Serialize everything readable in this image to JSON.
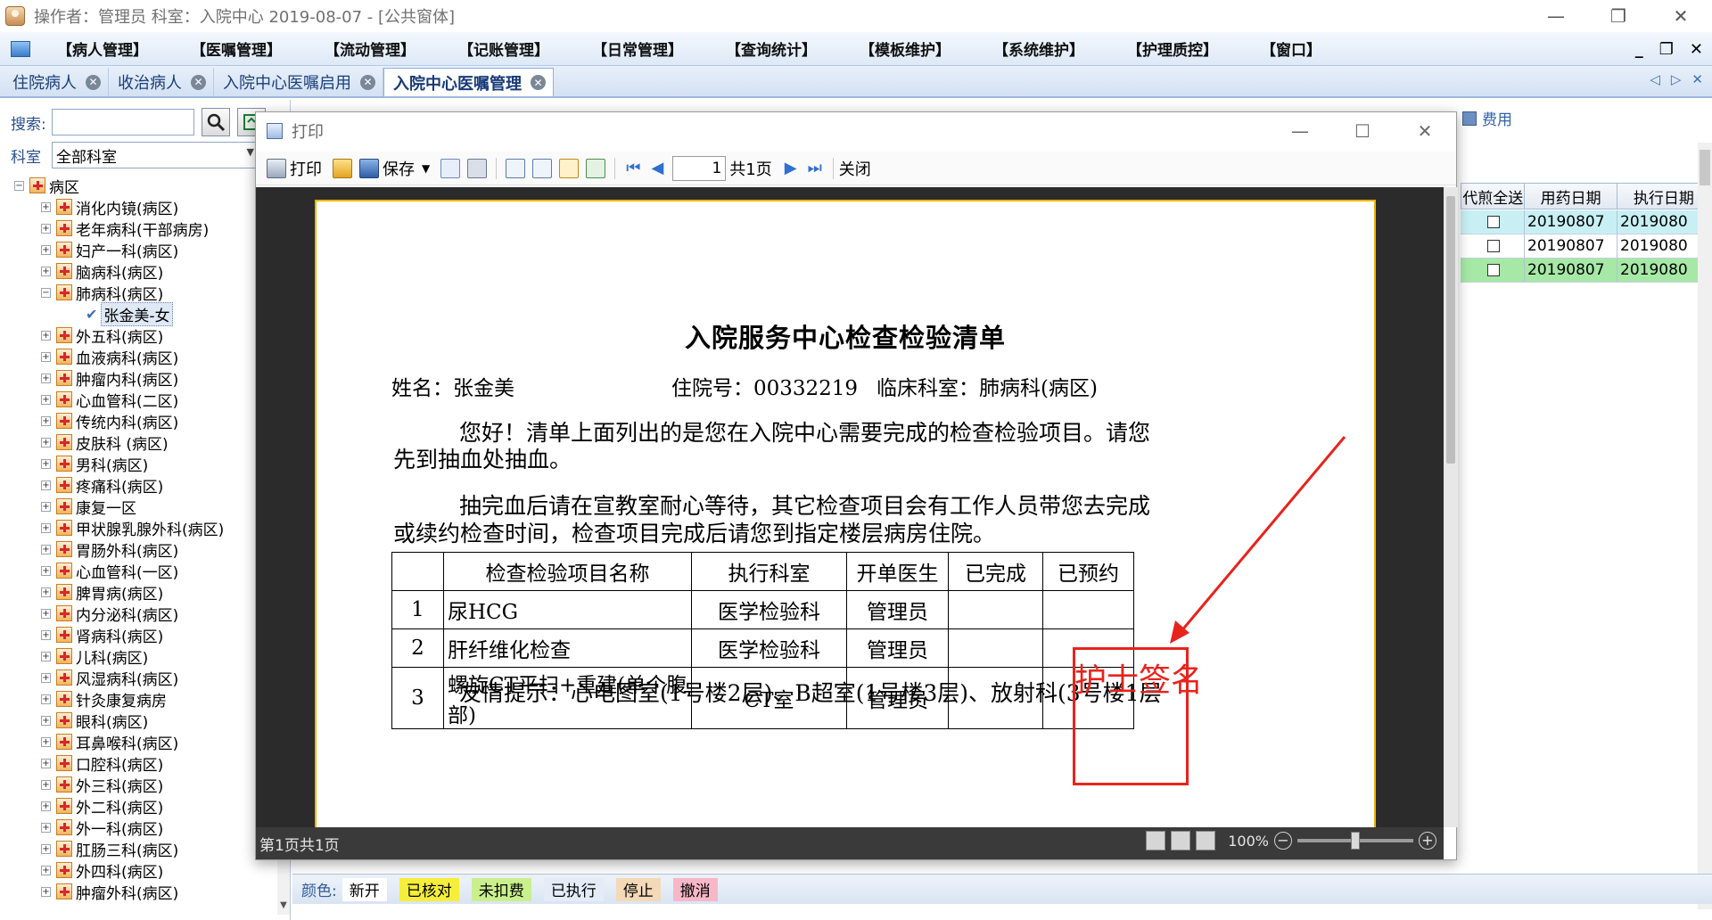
{
  "window": {
    "title": "操作者：管理员  科室：入院中心  2019-08-07 - [公共窗体]",
    "controls": [
      "—",
      "❐",
      "✕"
    ]
  },
  "menu": {
    "items": [
      "【病人管理】",
      "【医嘱管理】",
      "【流动管理】",
      "【记账管理】",
      "【日常管理】",
      "【查询统计】",
      "【模板维护】",
      "【系统维护】",
      "【护理质控】",
      "【窗口】"
    ],
    "mdi_controls": [
      "_",
      "❐",
      "✕"
    ]
  },
  "tabs": [
    {
      "label": "住院病人"
    },
    {
      "label": "收治病人"
    },
    {
      "label": "入院中心医嘱启用"
    },
    {
      "label": "入院中心医嘱管理"
    }
  ],
  "left_panel": {
    "search_label": "搜索:",
    "search_value": "",
    "dept_label": "科室",
    "dept_value": "全部科室",
    "tree_root": "病区",
    "wards_before": [
      "消化内镜(病区)",
      "老年病科(干部病房)",
      "妇产一科(病区)",
      "脑病科(病区)"
    ],
    "expanded_ward": "肺病科(病区)",
    "patient": "张金美-女",
    "wards_after": [
      "外五科(病区)",
      "血液病科(病区)",
      "肿瘤内科(病区)",
      "心血管科(二区)",
      "传统内科(病区)",
      "皮肤科 (病区)",
      "男科(病区)",
      "疼痛科(病区)",
      "康复一区",
      "甲状腺乳腺外科(病区)",
      "胃肠外科(病区)",
      "心血管科(一区)",
      "脾胃病(病区)",
      "内分泌科(病区)",
      "肾病科(病区)",
      "儿科(病区)",
      "风湿病科(病区)",
      "针灸康复病房",
      "眼科(病区)",
      "耳鼻喉科(病区)",
      "口腔科(病区)",
      "外三科(病区)",
      "外二科(病区)",
      "外一科(病区)",
      "肛肠三科(病区)",
      "外四科(病区)",
      "肿瘤外科(病区)"
    ]
  },
  "right_grid": {
    "fee_label": "费用",
    "headers": [
      "代煎全送",
      "用药日期",
      "执行日期"
    ],
    "rows": [
      {
        "date1": "20190807",
        "date2": "2019080",
        "color": "#c8f0f4"
      },
      {
        "date1": "20190807",
        "date2": "2019080",
        "color": "#ffffff"
      },
      {
        "date1": "20190807",
        "date2": "2019080",
        "color": "#a6e8a6"
      }
    ]
  },
  "status_legend": {
    "label": "颜色:",
    "items": [
      {
        "text": "新开",
        "color": "#ffffff"
      },
      {
        "text": "已核对",
        "color": "#f5ee3a"
      },
      {
        "text": "未扣费",
        "color": "#c9f08c"
      },
      {
        "text": "已执行",
        "color": "#e4ecf8"
      },
      {
        "text": "停止",
        "color": "#f4d9b8"
      },
      {
        "text": "撤消",
        "color": "#f6b8c8"
      }
    ]
  },
  "dialog": {
    "title": "打印",
    "toolbar": {
      "print": "打印",
      "save": "保存",
      "page_value": "1",
      "total_pages": "共1页",
      "close": "关闭"
    },
    "status_text": "第1页共1页",
    "zoom": "100%"
  },
  "document": {
    "title": "入院服务中心检查检验清单",
    "name_label": "姓名：张金美",
    "inpatient_no": "住院号：00332219",
    "dept": "临床科室：肺病科(病区)",
    "para1_line1": "您好！清单上面列出的是您在入院中心需要完成的检查检验项目。请您",
    "para1_line2": "先到抽血处抽血。",
    "para2_line1": "抽完血后请在宣教室耐心等待，其它检查项目会有工作人员带您去完成",
    "para2_line2": "或续约检查时间，检查项目完成后请您到指定楼层病房住院。",
    "table_headers": [
      "",
      "检查检验项目名称",
      "执行科室",
      "开单医生",
      "已完成",
      "已预约"
    ],
    "table_rows": [
      {
        "no": "1",
        "name": "尿HCG",
        "dept": "医学检验科",
        "doctor": "管理员",
        "done": "",
        "booked": ""
      },
      {
        "no": "2",
        "name": "肝纤维化检查",
        "dept": "医学检验科",
        "doctor": "管理员",
        "done": "",
        "booked": ""
      },
      {
        "no": "3",
        "name": "螺旋CT平扫+重建(单个腹部)",
        "dept": "CT室",
        "doctor": "管理员",
        "done": "",
        "booked": ""
      }
    ],
    "tip": "友情提示：心电图室(1号楼2层)、B超室(1号楼3层)、放射科(3号楼1层"
  },
  "annotation": {
    "text": "护士签名",
    "color": "#e8231c"
  }
}
